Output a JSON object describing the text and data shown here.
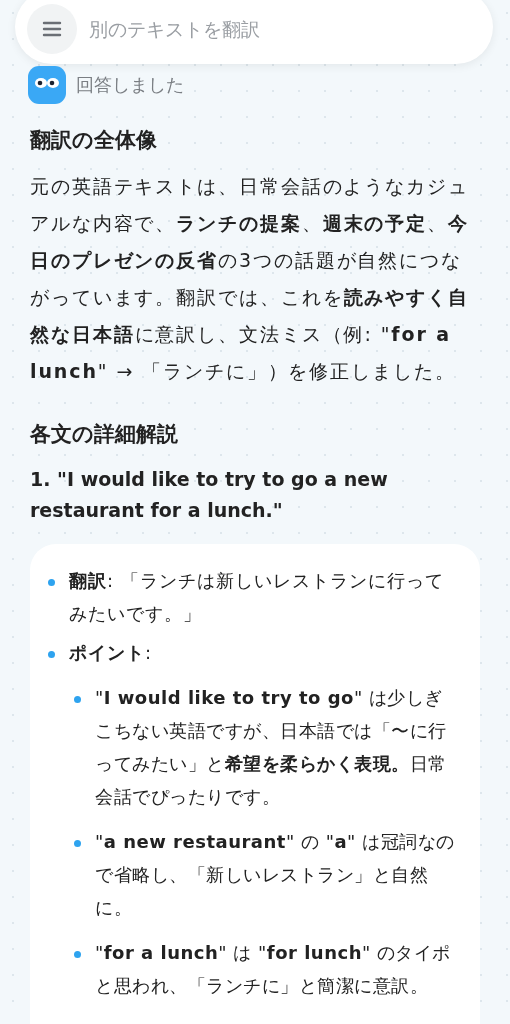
{
  "search": {
    "placeholder": "別のテキストを翻訳"
  },
  "status": {
    "text": "回答しました"
  },
  "overview": {
    "heading": "翻訳の全体像",
    "body": "元の英語テキストは、日常会話のようなカジュアルな内容で、**ランチの提案**、**週末の予定**、**今日のプレゼンの反省**の3つの話題が自然につながっています。翻訳では、これを**読みやすく自然な日本語**に意訳し、文法ミス（例: \"**for a lunch**\" → 「ランチに」）を修正しました。"
  },
  "details": {
    "heading": "各文の詳細解説",
    "item_title": "1. \"I would like to try to go a new restaurant for a lunch.\"",
    "bullets": [
      {
        "text": "**翻訳**: 「ランチは新しいレストランに行ってみたいです。」"
      },
      {
        "text": "**ポイント**:",
        "children": [
          {
            "text": "\"**I would like to try to go**\" は少しぎこちない英語ですが、日本語では「〜に行ってみたい」と**希望を柔らかく表現。**日常会話でぴったりです。"
          },
          {
            "text": "\"**a new restaurant**\" の \"**a**\" は冠詞なので省略し、「新しいレストラン」と自然に。"
          },
          {
            "text": "\"**for a lunch**\" は \"**for lunch**\" のタイポと思われ、「ランチに」と簡潔に意訳。"
          }
        ]
      }
    ]
  }
}
